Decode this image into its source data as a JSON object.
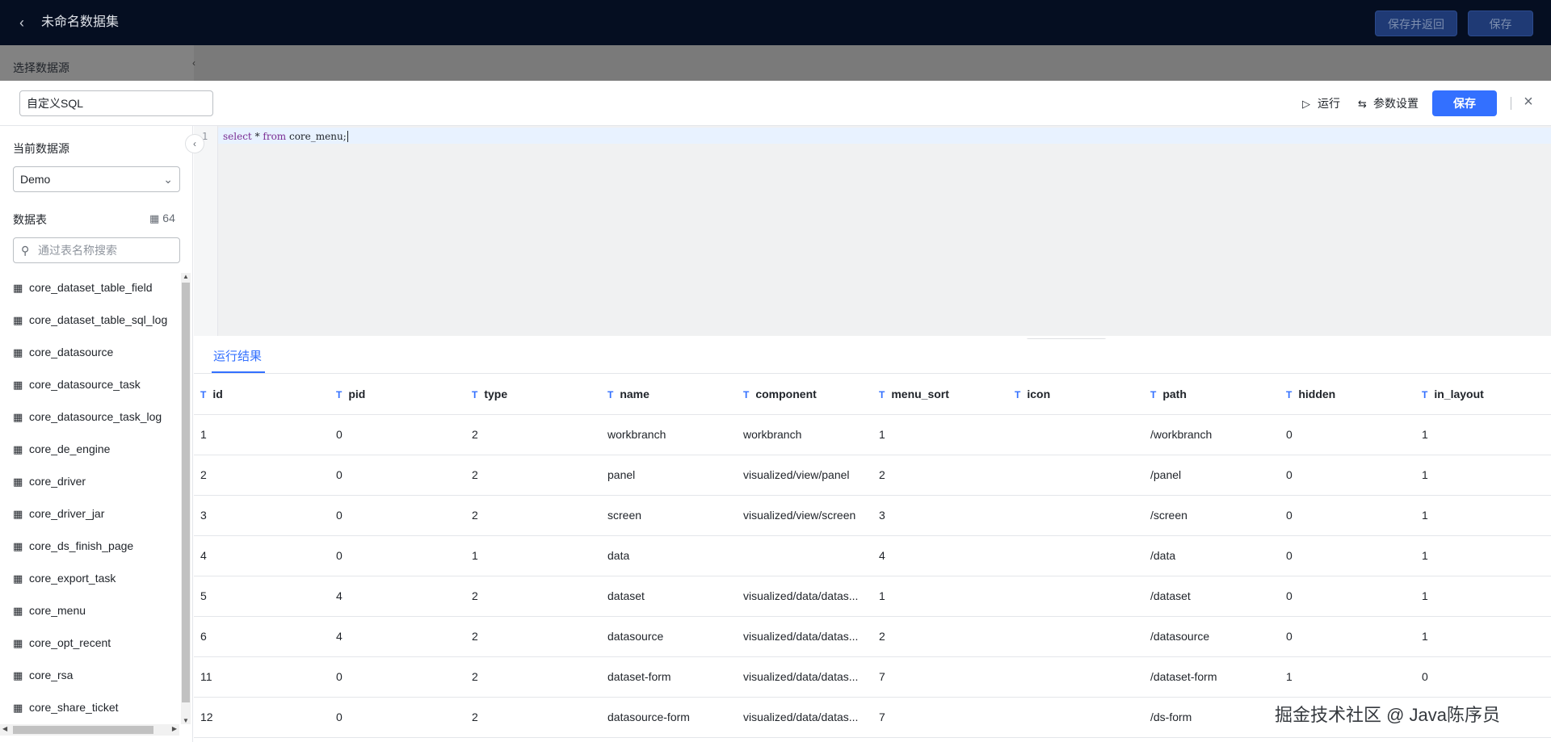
{
  "topbar": {
    "title": "未命名数据集",
    "save_return_label": "保存并返回",
    "save_label": "保存"
  },
  "mask": {
    "datasource_label": "选择数据源"
  },
  "drawer": {
    "name_value": "自定义SQL",
    "run_label": "运行",
    "params_label": "参数设置",
    "save_label": "保存"
  },
  "left": {
    "current_ds_label": "当前数据源",
    "current_ds_value": "Demo",
    "tables_label": "数据表",
    "tables_count": "64",
    "search_placeholder": "通过表名称搜索",
    "tables": [
      "core_dataset_table_field",
      "core_dataset_table_sql_log",
      "core_datasource",
      "core_datasource_task",
      "core_datasource_task_log",
      "core_de_engine",
      "core_driver",
      "core_driver_jar",
      "core_ds_finish_page",
      "core_export_task",
      "core_menu",
      "core_opt_recent",
      "core_rsa",
      "core_share_ticket"
    ]
  },
  "editor": {
    "line_number": "1",
    "kw_select": "select",
    "op_star": " * ",
    "kw_from": "from",
    "rest": " core_menu;"
  },
  "results": {
    "tab_label": "运行结果",
    "type_marker": "T",
    "columns": [
      "id",
      "pid",
      "type",
      "name",
      "component",
      "menu_sort",
      "icon",
      "path",
      "hidden",
      "in_layout"
    ],
    "rows": [
      [
        "1",
        "0",
        "2",
        "workbranch",
        "workbranch",
        "1",
        "",
        "/workbranch",
        "0",
        "1"
      ],
      [
        "2",
        "0",
        "2",
        "panel",
        "visualized/view/panel",
        "2",
        "",
        "/panel",
        "0",
        "1"
      ],
      [
        "3",
        "0",
        "2",
        "screen",
        "visualized/view/screen",
        "3",
        "",
        "/screen",
        "0",
        "1"
      ],
      [
        "4",
        "0",
        "1",
        "data",
        "",
        "4",
        "",
        "/data",
        "0",
        "1"
      ],
      [
        "5",
        "4",
        "2",
        "dataset",
        "visualized/data/datas...",
        "1",
        "",
        "/dataset",
        "0",
        "1"
      ],
      [
        "6",
        "4",
        "2",
        "datasource",
        "visualized/data/datas...",
        "2",
        "",
        "/datasource",
        "0",
        "1"
      ],
      [
        "11",
        "0",
        "2",
        "dataset-form",
        "visualized/data/datas...",
        "7",
        "",
        "/dataset-form",
        "1",
        "0"
      ],
      [
        "12",
        "0",
        "2",
        "datasource-form",
        "visualized/data/datas...",
        "7",
        "",
        "/ds-form",
        "",
        ""
      ]
    ]
  },
  "watermark": "掘金技术社区 @ Java陈序员",
  "colors": {
    "accent": "#3370ff",
    "topbar": "#050e21"
  }
}
